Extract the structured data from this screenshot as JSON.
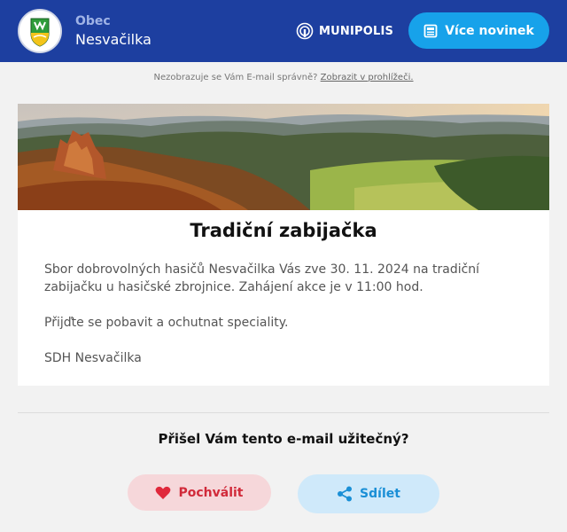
{
  "header": {
    "municipality_label": "Obec",
    "municipality_name": "Nesvačilka",
    "brand": "MUNIPOLIS",
    "more_news_label": "Více novinek"
  },
  "notice": {
    "text": "Nezobrazuje se Vám E-mail správně?",
    "link": "Zobrazit v prohlížeči."
  },
  "article": {
    "title": "Tradiční zabijačka",
    "paragraphs": [
      "Sbor dobrovolných hasičů Nesvačilka Vás zve 30. 11. 2024 na tradiční zabijačku u hasičské zbrojnice. Zahájení akce je v 11:00 hod.",
      "Přijďte se pobavit a ochutnat speciality.",
      "SDH Nesvačilka"
    ]
  },
  "feedback": {
    "question": "Přišel Vám tento e-mail užitečný?",
    "praise_label": "Pochválit",
    "share_label": "Sdílet"
  },
  "colors": {
    "header_bg": "#1d3fa0",
    "primary_button": "#17a2ea",
    "praise_red": "#d12a3a",
    "share_blue": "#1a8fd6"
  }
}
